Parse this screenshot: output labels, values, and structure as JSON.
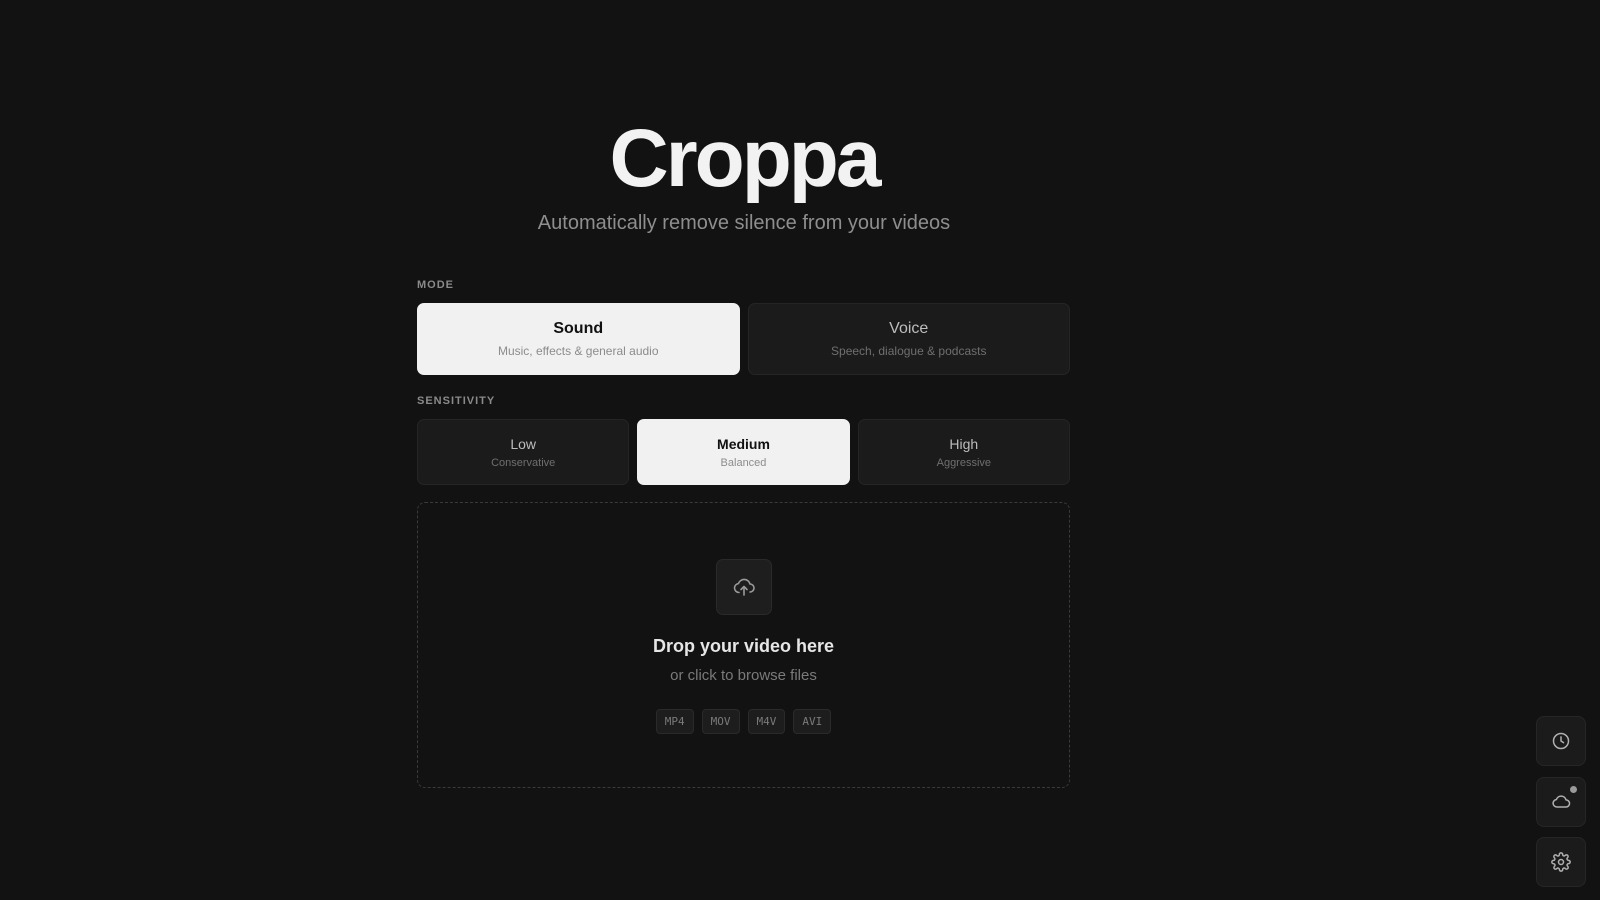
{
  "app": {
    "title": "Croppa",
    "subtitle": "Automatically remove silence from your videos"
  },
  "mode": {
    "label": "MODE",
    "options": [
      {
        "title": "Sound",
        "desc": "Music, effects & general audio",
        "selected": true
      },
      {
        "title": "Voice",
        "desc": "Speech, dialogue & podcasts",
        "selected": false
      }
    ]
  },
  "sensitivity": {
    "label": "SENSITIVITY",
    "options": [
      {
        "title": "Low",
        "desc": "Conservative",
        "selected": false
      },
      {
        "title": "Medium",
        "desc": "Balanced",
        "selected": true
      },
      {
        "title": "High",
        "desc": "Aggressive",
        "selected": false
      }
    ]
  },
  "dropzone": {
    "icon": "cloud-upload-icon",
    "title": "Drop your video here",
    "subtitle": "or click to browse files",
    "formats": [
      "MP4",
      "MOV",
      "M4V",
      "AVI"
    ]
  },
  "sidebar": {
    "buttons": [
      {
        "icon": "clock-icon"
      },
      {
        "icon": "cloud-icon",
        "has_badge": true
      },
      {
        "icon": "gear-icon"
      }
    ]
  },
  "colors": {
    "background": "#121212",
    "selected": "#f1f1f1",
    "card": "#1b1b1b"
  }
}
